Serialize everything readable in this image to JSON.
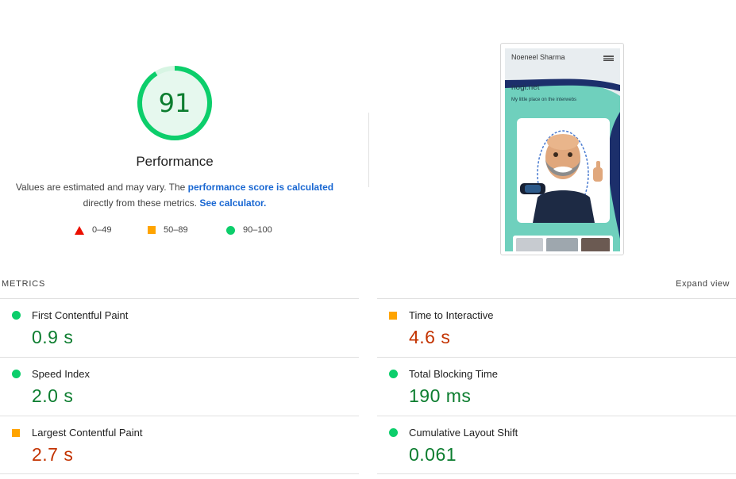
{
  "performance": {
    "score": "91",
    "score_fraction": 0.91,
    "title": "Performance",
    "desc_prefix": "Values are estimated and may vary. The ",
    "desc_link1": "performance score is calculated",
    "desc_mid": "directly from these metrics. ",
    "desc_link2": "See calculator.",
    "colors": {
      "good": "#0cce6b",
      "good_text": "#0c7d2f",
      "average": "#ffa400",
      "average_text": "#c33300",
      "poor": "#eb0f00"
    }
  },
  "legend": [
    {
      "shape": "triangle-icon",
      "label": "0–49"
    },
    {
      "shape": "square-icon",
      "label": "50–89"
    },
    {
      "shape": "circle-icon",
      "label": "90–100"
    }
  ],
  "screenshot": {
    "header_name": "Noeneel Sharma",
    "site_name": "nogi.net",
    "tagline": "My little place on the interwebs"
  },
  "metrics": {
    "section_label": "METRICS",
    "expand_label": "Expand view",
    "items": [
      {
        "title": "First Contentful Paint",
        "value": "0.9 s",
        "rating": "good"
      },
      {
        "title": "Time to Interactive",
        "value": "4.6 s",
        "rating": "average"
      },
      {
        "title": "Speed Index",
        "value": "2.0 s",
        "rating": "good"
      },
      {
        "title": "Total Blocking Time",
        "value": "190 ms",
        "rating": "good"
      },
      {
        "title": "Largest Contentful Paint",
        "value": "2.7 s",
        "rating": "average"
      },
      {
        "title": "Cumulative Layout Shift",
        "value": "0.061",
        "rating": "good"
      }
    ]
  }
}
